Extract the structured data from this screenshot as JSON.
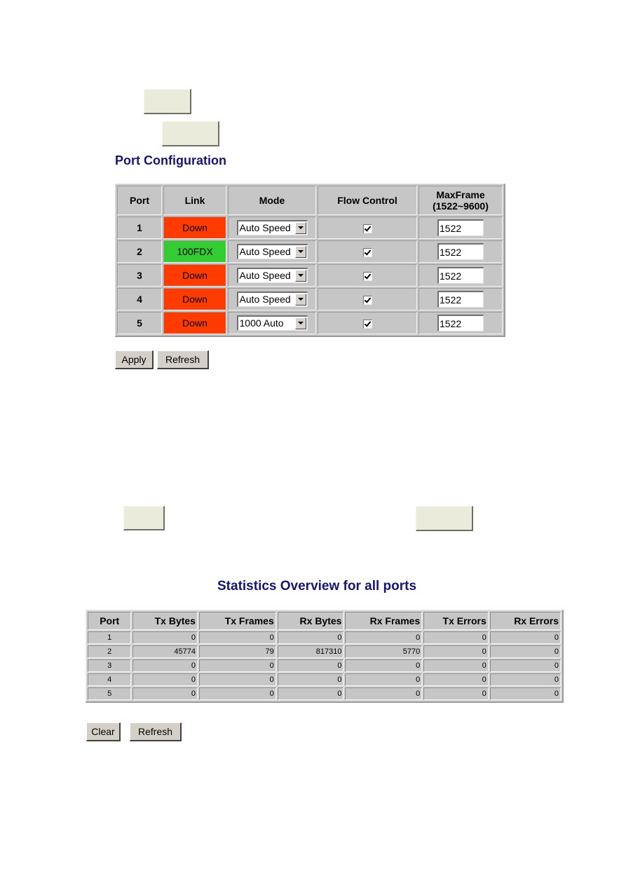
{
  "blank_buttons": [
    "",
    "",
    "",
    ""
  ],
  "port_config": {
    "title": "Port Configuration",
    "headers": {
      "port": "Port",
      "link": "Link",
      "mode": "Mode",
      "flow_control": "Flow Control",
      "maxframe_line1": "MaxFrame",
      "maxframe_line2": "(1522~9600)"
    },
    "rows": [
      {
        "port": "1",
        "link": "Down",
        "link_status": "down",
        "mode": "Auto Speed",
        "flow_control": true,
        "maxframe": "1522"
      },
      {
        "port": "2",
        "link": "100FDX",
        "link_status": "up",
        "mode": "Auto Speed",
        "flow_control": true,
        "maxframe": "1522"
      },
      {
        "port": "3",
        "link": "Down",
        "link_status": "down",
        "mode": "Auto Speed",
        "flow_control": true,
        "maxframe": "1522"
      },
      {
        "port": "4",
        "link": "Down",
        "link_status": "down",
        "mode": "Auto Speed",
        "flow_control": true,
        "maxframe": "1522"
      },
      {
        "port": "5",
        "link": "Down",
        "link_status": "down",
        "mode": "1000 Auto",
        "flow_control": true,
        "maxframe": "1522"
      }
    ],
    "apply_label": "Apply",
    "refresh_label": "Refresh"
  },
  "colors": {
    "link_down": "#ff3b00",
    "link_up": "#33cc33",
    "title": "#14147a"
  },
  "statistics": {
    "title": "Statistics Overview for all ports",
    "headers": [
      "Port",
      "Tx Bytes",
      "Tx Frames",
      "Rx Bytes",
      "Rx Frames",
      "Tx Errors",
      "Rx Errors"
    ],
    "rows": [
      [
        "1",
        "0",
        "0",
        "0",
        "0",
        "0",
        "0"
      ],
      [
        "2",
        "45774",
        "79",
        "817310",
        "5770",
        "0",
        "0"
      ],
      [
        "3",
        "0",
        "0",
        "0",
        "0",
        "0",
        "0"
      ],
      [
        "4",
        "0",
        "0",
        "0",
        "0",
        "0",
        "0"
      ],
      [
        "5",
        "0",
        "0",
        "0",
        "0",
        "0",
        "0"
      ]
    ],
    "clear_label": "Clear",
    "refresh_label": "Refresh"
  }
}
